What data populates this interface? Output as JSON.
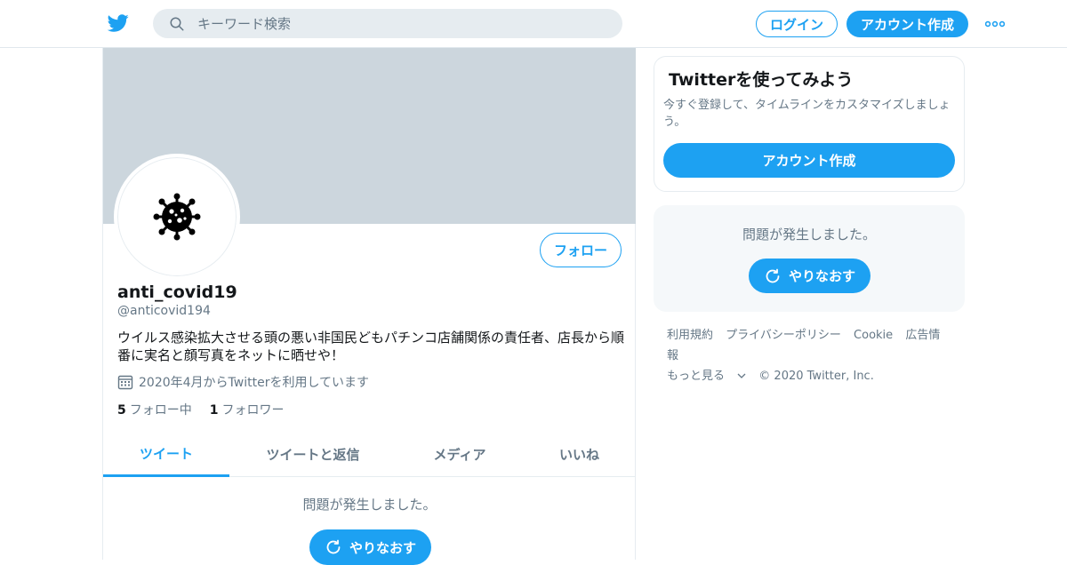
{
  "header": {
    "search_placeholder": "キーワード検索",
    "login_label": "ログイン",
    "signup_label": "アカウント作成"
  },
  "profile": {
    "display_name": "anti_covid19",
    "handle": "@anticovid194",
    "bio": "ウイルス感染拡大させる頭の悪い非国民どもパチンコ店舗関係の責任者、店長から順番に実名と顔写真をネットに晒せや！",
    "joined": "2020年4月からTwitterを利用しています",
    "follow_label": "フォロー",
    "following_count": "5",
    "following_label": "フォロー中",
    "followers_count": "1",
    "followers_label": "フォロワー"
  },
  "tabs": [
    {
      "label": "ツイート"
    },
    {
      "label": "ツイートと返信"
    },
    {
      "label": "メディア"
    },
    {
      "label": "いいね"
    }
  ],
  "timeline": {
    "error_message": "問題が発生しました。",
    "retry_label": "やりなおす"
  },
  "sidebar": {
    "card_title": "Twitterを使ってみよう",
    "card_text": "今すぐ登録して、タイムラインをカスタマイズしましょう。",
    "card_signup_label": "アカウント作成",
    "error_message": "問題が発生しました。",
    "retry_label": "やりなおす"
  },
  "footer": {
    "links": [
      "利用規約",
      "プライバシーポリシー",
      "Cookie",
      "広告情報",
      "もっと見る"
    ],
    "copyright": "© 2020 Twitter, Inc."
  },
  "colors": {
    "brand": "#1da1f2",
    "banner": "#ccd6dd",
    "muted_text": "#657786"
  }
}
